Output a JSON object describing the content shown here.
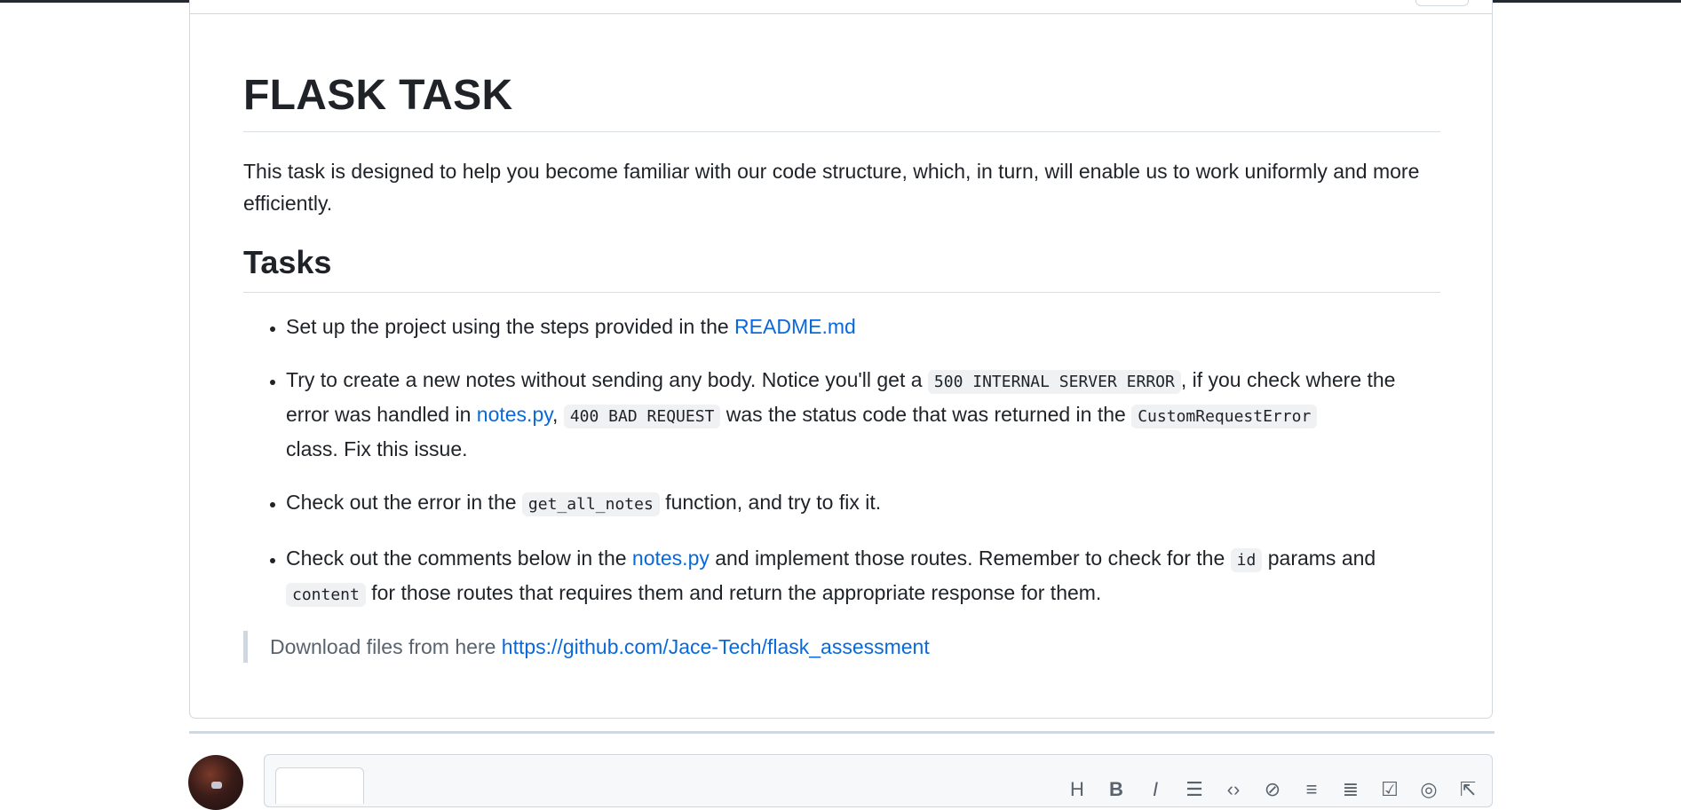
{
  "title": "FLASK TASK",
  "intro": "This task is designed to help you become familiar with our code structure, which, in turn, will enable us to work uniformly and more efficiently.",
  "tasks_heading": "Tasks",
  "tasks": {
    "t1": {
      "text_before": "Set up the project using the steps provided in the ",
      "link": "README.md"
    },
    "t2": {
      "text_a": "Try to create a new notes without sending any body. Notice you'll get a ",
      "code_a": "500 INTERNAL SERVER ERROR",
      "text_b": ", if you check where the error was handled in ",
      "link": "notes.py",
      "text_c": ", ",
      "code_b": "400 BAD REQUEST",
      "text_d": " was the status code that was returned in the ",
      "code_c": "CustomRequestError",
      "text_e": " class. Fix this issue."
    },
    "t3": {
      "text_a": "Check out the error in the ",
      "code": "get_all_notes",
      "text_b": " function, and try to fix it."
    },
    "t4": {
      "text_a": "Check out the comments below in the ",
      "link": "notes.py",
      "text_b": " and implement those routes. Remember to check for the ",
      "code_a": "id",
      "text_c": " params and ",
      "code_b": "content",
      "text_d": " for those routes that requires them and return the appropriate response for them."
    }
  },
  "quote": {
    "text": "Download files from here ",
    "link": "https://github.com/Jace-Tech/flask_assessment"
  },
  "toolbar_icons": [
    "heading-icon",
    "bold-icon",
    "italic-icon",
    "quote-icon",
    "code-icon",
    "link-icon",
    "ordered-list-icon",
    "unordered-list-icon",
    "task-list-icon",
    "mention-icon",
    "reference-icon"
  ]
}
